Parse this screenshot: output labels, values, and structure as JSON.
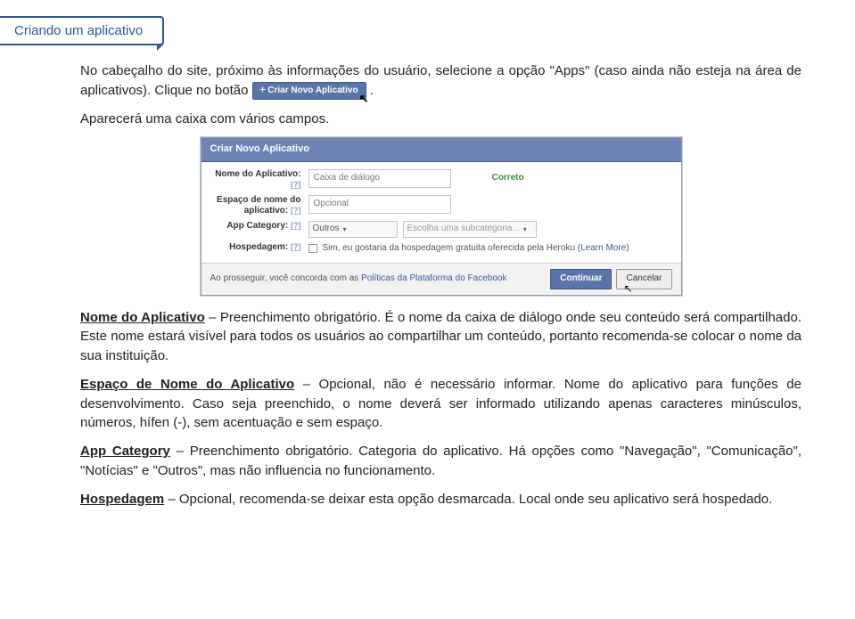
{
  "page": {
    "title": "Criando um aplicativo",
    "intro1_a": "No cabeçalho do site, próximo às informações do usuário, selecione a opção \"Apps\" (caso ainda não esteja na área de aplicativos). Clique no botão ",
    "intro1_b": ".",
    "btn_create": "+ Criar Novo Aplicativo",
    "intro2": "Aparecerá uma caixa com vários campos."
  },
  "dialog": {
    "title": "Criar Novo Aplicativo",
    "rows": {
      "nome_label": "Nome do Aplicativo:",
      "nome_value": "Caixa de diálogo",
      "nome_ok": "Correto",
      "espaco_label": "Espaço de nome do aplicativo:",
      "espaco_value": "Opcional",
      "cat_label": "App Category:",
      "cat_value": "Outros",
      "cat_sub": "Escolha uma subcategoria...",
      "host_label": "Hospedagem:",
      "host_text": "Sim, eu gostaria da hospedagem gratuita oferecida pela Heroku (",
      "host_learn": "Learn More",
      "host_close": ")",
      "help": "[?]"
    },
    "footer": {
      "text1": "Ao prosseguir, você concorda com as ",
      "link": "Políticas da Plataforma do Facebook",
      "text2": "",
      "continue": "Continuar",
      "cancel": "Cancelar"
    }
  },
  "fields": {
    "f1_title": "Nome do Aplicativo",
    "f1_text": " – Preenchimento obrigatório. É o nome da caixa de diálogo onde seu conteúdo será compartilhado. Este nome estará visível para todos os usuários ao compartilhar um conteúdo, portanto recomenda-se colocar o nome da sua instituição.",
    "f2_title": "Espaço de Nome do Aplicativo",
    "f2_text": " – Opcional, não é necessário informar. Nome do aplicativo para funções de desenvolvimento. Caso seja preenchido, o nome deverá ser informado utilizando apenas caracteres minúsculos, números, hífen (-), sem acentuação e sem espaço.",
    "f3_title": "App Category",
    "f3_text": " – Preenchimento obrigatório. Categoria do aplicativo. Há opções como \"Navegação\", \"Comunicação\", \"Notícias\" e \"Outros\", mas não influencia no funcionamento.",
    "f4_title": "Hospedagem",
    "f4_text": " – Opcional, recomenda-se deixar esta opção desmarcada. Local onde seu aplicativo será hospedado."
  }
}
